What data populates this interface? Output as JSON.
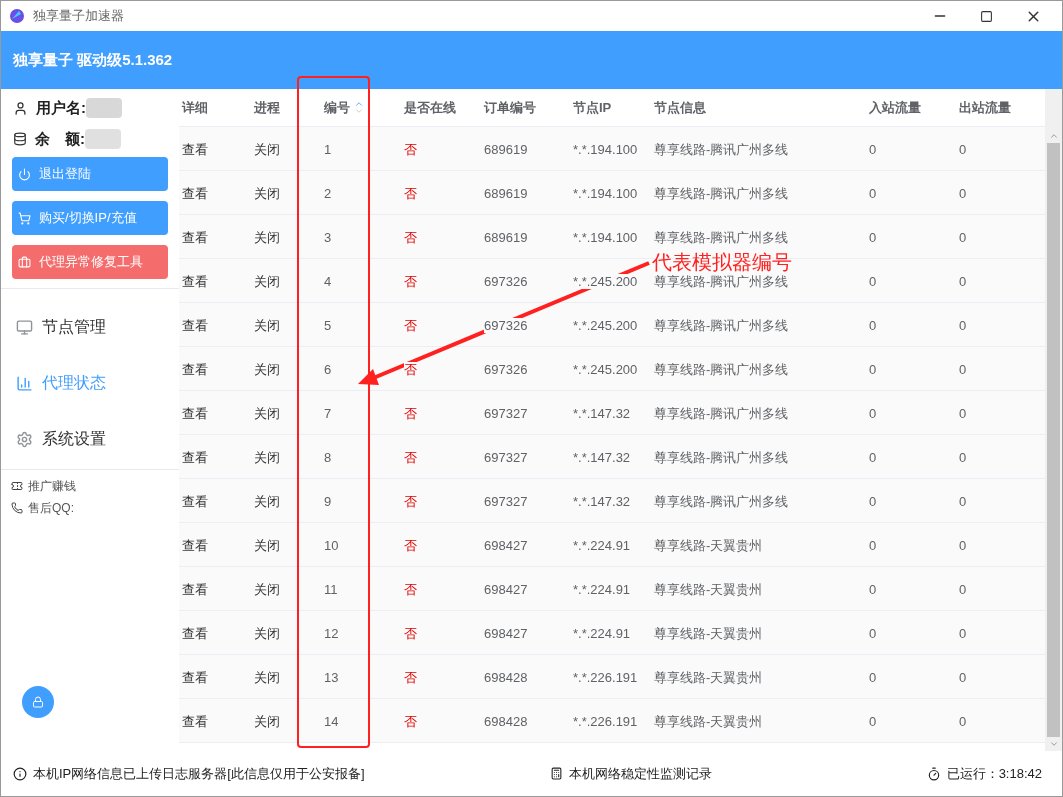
{
  "window": {
    "title": "独享量子加速器"
  },
  "header": {
    "title": "独享量子 驱动级5.1.362"
  },
  "account": {
    "username_label": "用户名:",
    "balance_label": "余　额:"
  },
  "actions": [
    {
      "label": "退出登陆",
      "kind": "logout"
    },
    {
      "label": "购买/切换IP/充值",
      "kind": "cart"
    },
    {
      "label": "代理异常修复工具",
      "kind": "repair"
    }
  ],
  "nav": [
    {
      "label": "节点管理",
      "kind": "monitor",
      "selected": false
    },
    {
      "label": "代理状态",
      "kind": "chart",
      "selected": true
    },
    {
      "label": "系统设置",
      "kind": "gear",
      "selected": false
    }
  ],
  "links": [
    {
      "label": "推广赚钱",
      "kind": "ticket"
    },
    {
      "label": "售后QQ:",
      "kind": "phone"
    }
  ],
  "table": {
    "columns": [
      "详细",
      "进程",
      "编号",
      "是否在线",
      "订单编号",
      "节点IP",
      "节点信息",
      "入站流量",
      "出站流量"
    ],
    "rows": [
      [
        "查看",
        "关闭",
        "1",
        "否",
        "689619",
        "*.*.194.100",
        "尊享线路-腾讯广州多线",
        "0",
        "0"
      ],
      [
        "查看",
        "关闭",
        "2",
        "否",
        "689619",
        "*.*.194.100",
        "尊享线路-腾讯广州多线",
        "0",
        "0"
      ],
      [
        "查看",
        "关闭",
        "3",
        "否",
        "689619",
        "*.*.194.100",
        "尊享线路-腾讯广州多线",
        "0",
        "0"
      ],
      [
        "查看",
        "关闭",
        "4",
        "否",
        "697326",
        "*.*.245.200",
        "尊享线路-腾讯广州多线",
        "0",
        "0"
      ],
      [
        "查看",
        "关闭",
        "5",
        "否",
        "697326",
        "*.*.245.200",
        "尊享线路-腾讯广州多线",
        "0",
        "0"
      ],
      [
        "查看",
        "关闭",
        "6",
        "否",
        "697326",
        "*.*.245.200",
        "尊享线路-腾讯广州多线",
        "0",
        "0"
      ],
      [
        "查看",
        "关闭",
        "7",
        "否",
        "697327",
        "*.*.147.32",
        "尊享线路-腾讯广州多线",
        "0",
        "0"
      ],
      [
        "查看",
        "关闭",
        "8",
        "否",
        "697327",
        "*.*.147.32",
        "尊享线路-腾讯广州多线",
        "0",
        "0"
      ],
      [
        "查看",
        "关闭",
        "9",
        "否",
        "697327",
        "*.*.147.32",
        "尊享线路-腾讯广州多线",
        "0",
        "0"
      ],
      [
        "查看",
        "关闭",
        "10",
        "否",
        "698427",
        "*.*.224.91",
        "尊享线路-天翼贵州",
        "0",
        "0"
      ],
      [
        "查看",
        "关闭",
        "11",
        "否",
        "698427",
        "*.*.224.91",
        "尊享线路-天翼贵州",
        "0",
        "0"
      ],
      [
        "查看",
        "关闭",
        "12",
        "否",
        "698427",
        "*.*.224.91",
        "尊享线路-天翼贵州",
        "0",
        "0"
      ],
      [
        "查看",
        "关闭",
        "13",
        "否",
        "698428",
        "*.*.226.191",
        "尊享线路-天翼贵州",
        "0",
        "0"
      ],
      [
        "查看",
        "关闭",
        "14",
        "否",
        "698428",
        "*.*.226.191",
        "尊享线路-天翼贵州",
        "0",
        "0"
      ]
    ]
  },
  "annotation": {
    "text": "代表模拟器编号"
  },
  "status_bar": {
    "left": "本机IP网络信息已上传日志服务器[此信息仅用于公安报备]",
    "center": "本机网络稳定性监测记录",
    "right": "已运行：3:18:42"
  }
}
